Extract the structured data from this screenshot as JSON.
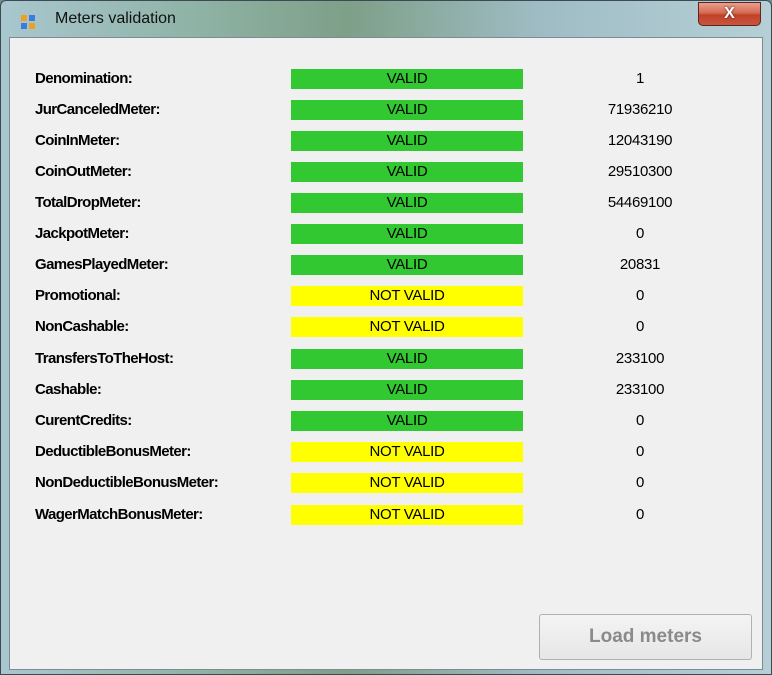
{
  "window": {
    "title": "Meters validation",
    "close_label": "X"
  },
  "meters": [
    {
      "label": "Denomination:",
      "status": "VALID",
      "value": "1"
    },
    {
      "label": "JurCanceledMeter:",
      "status": "VALID",
      "value": "71936210"
    },
    {
      "label": "CoinInMeter:",
      "status": "VALID",
      "value": "12043190"
    },
    {
      "label": "CoinOutMeter:",
      "status": "VALID",
      "value": "29510300"
    },
    {
      "label": "TotalDropMeter:",
      "status": "VALID",
      "value": "54469100"
    },
    {
      "label": "JackpotMeter:",
      "status": "VALID",
      "value": "0"
    },
    {
      "label": "GamesPlayedMeter:",
      "status": "VALID",
      "value": "20831"
    },
    {
      "label": "Promotional:",
      "status": "NOT VALID",
      "value": "0"
    },
    {
      "label": "NonCashable:",
      "status": "NOT VALID",
      "value": "0"
    },
    {
      "label": "TransfersToTheHost:",
      "status": "VALID",
      "value": "233100"
    },
    {
      "label": "Cashable:",
      "status": "VALID",
      "value": "233100"
    },
    {
      "label": "CurentCredits:",
      "status": "VALID",
      "value": "0"
    },
    {
      "label": "DeductibleBonusMeter:",
      "status": "NOT VALID",
      "value": "0"
    },
    {
      "label": "NonDeductibleBonusMeter:",
      "status": "NOT VALID",
      "value": "0"
    },
    {
      "label": "WagerMatchBonusMeter:",
      "status": "NOT VALID",
      "value": "0"
    }
  ],
  "colors": {
    "valid": "#32c832",
    "not_valid": "#ffff00"
  },
  "load_button": {
    "label": "Load meters"
  }
}
